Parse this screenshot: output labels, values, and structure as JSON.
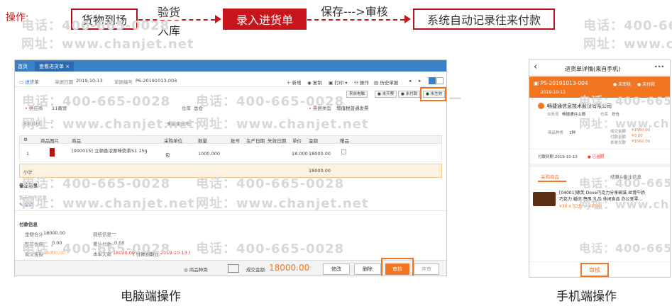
{
  "flow": {
    "op_label": "操作:",
    "step1": "货物到场",
    "step2_line1": "验货",
    "step2_line2": "入库",
    "step3": "录入进货单",
    "step4_label": "保存--->审核",
    "step5": "系统自动记录往来付款"
  },
  "watermark": {
    "phone": "电话：400-665-0028",
    "site": "网址：www.chanjet.net",
    "phone_short": "电话：400-665-",
    "site_short": "网址：www.chan"
  },
  "desktop": {
    "tab_home": "首页",
    "tab_view": "查看进货单 ×",
    "doc_label": "进货单",
    "date_label": "单据日期",
    "date_value": "2019-10-13",
    "code_label": "单据编号",
    "code_value": "PS-20191013-003",
    "toolbar": [
      "新增",
      "复制",
      "打印 ▾",
      "操作",
      "历史单据"
    ],
    "status_tags": [
      "来自电脑",
      "未开票",
      "未付款",
      "未生效"
    ],
    "supplier_label": "供应商",
    "supplier_value": "11商贸",
    "warehouse_label": "仓库",
    "warehouse_value": "总仓",
    "invoice_label": "票据类型",
    "invoice_value": "增值税普通发票",
    "src_label": "来源单据",
    "src_value": "---",
    "srcno_label": "来源单据号",
    "srcno_value": "---",
    "table_headers": [
      "商品图片",
      "商品",
      "采购单位",
      "数量",
      "批号",
      "生产日期",
      "失效日期",
      "单价",
      "金额",
      "赠品"
    ],
    "row": {
      "idx": "1",
      "product": "[000015] 立顿香浓原味奶茶S1 15g",
      "unit": "包",
      "qty": "1000.000",
      "price": "18.000",
      "amount": "18000.00"
    },
    "subtotal_label": "小计",
    "subtotal_amount": "18000.00",
    "remark_title": "备注信息",
    "attach_label": "暂无附件信息",
    "edit_label": "编辑",
    "pay_title": "付款信息",
    "total_label": "金额合计",
    "total_value": "18000.00",
    "discount_label": "整单优惠",
    "discount_value": "0.00",
    "deal_label": "成交金额",
    "deal_value": "18000.00",
    "spec_label": "现结信息",
    "spec_value": "---",
    "paid_label": "累计付款",
    "paid_value": "0.00",
    "owe_label": "本单欠款",
    "owe_value": "18000.00",
    "due_label": "( 付款到期日:",
    "due_value": "2019-10-13 )",
    "bottom_goods": "商品种类",
    "bottom_deal_label": "成交金额:",
    "bottom_deal_value": "18000.00",
    "btn_edit": "修改",
    "btn_delete": "删除",
    "btn_audit": "审核",
    "btn_unaudit": "弃审",
    "caption": "电脑端操作"
  },
  "mobile": {
    "title": "进货单详情(来自手机)",
    "more": "•••",
    "code": "PS-20191013-004",
    "date": "2019-10-13",
    "tag_unaudit": "未审核",
    "tag_unpaid": "未付款",
    "company": "畅捷通信息技术股份有限公司",
    "clerk_label": "业务员",
    "clerk_value": "畅捷通许山珊",
    "wh_label": "仓库",
    "wh_value": "总仓",
    "kinds_label": "商品种类",
    "kinds_value": "1种",
    "deal_label": "成交金额",
    "deal_value": "¥1560.00",
    "paid_label": "付款金额",
    "paid_value": "¥0.00",
    "owe_label": "本单欠款",
    "owe_value": "¥1560.00",
    "due_label": "付款到期 2019-10-13",
    "overdue": "已逾期",
    "tab_goods": "采购商品",
    "tab_settle": "结算&备注信息",
    "product_line1": "[04001]德芙 Dove巧克力分享碗装 丝滑牛奶",
    "product_line2": "巧克力 婚庆 糖果 礼品 休闲食品 办公室零...",
    "product_price": "¥30 x 52盒 = ¥1560",
    "audit_btn": "审核",
    "caption": "手机端操作"
  }
}
